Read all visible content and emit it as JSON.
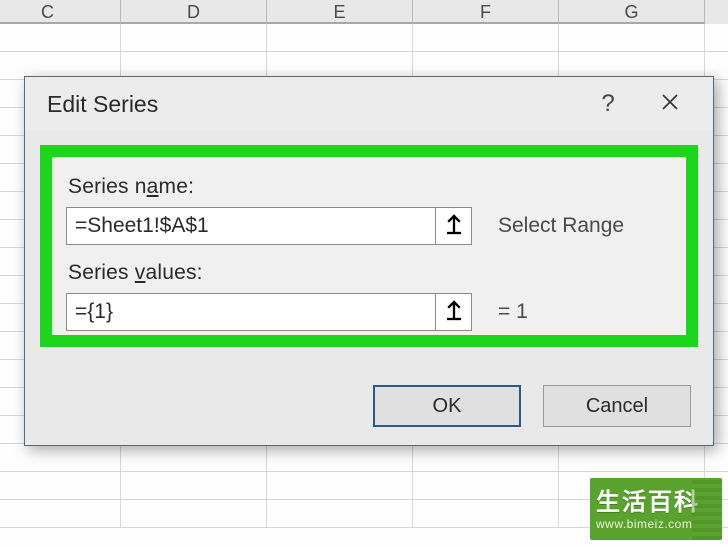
{
  "columns": [
    "C",
    "D",
    "E",
    "F",
    "G"
  ],
  "dialog": {
    "title": "Edit Series",
    "help": "?",
    "close": "✕",
    "series_name_label_pre": "Series n",
    "series_name_label_u": "a",
    "series_name_label_post": "me:",
    "series_name_value": "=Sheet1!$A$1",
    "series_name_hint": "Select Range",
    "series_values_label_pre": "Series ",
    "series_values_label_u": "v",
    "series_values_label_post": "alues:",
    "series_values_value": "={1}",
    "series_values_hint": "= 1",
    "ok": "OK",
    "cancel": "Cancel"
  },
  "watermark": {
    "title": "生活百科",
    "url": "www.bimeiz.com"
  }
}
